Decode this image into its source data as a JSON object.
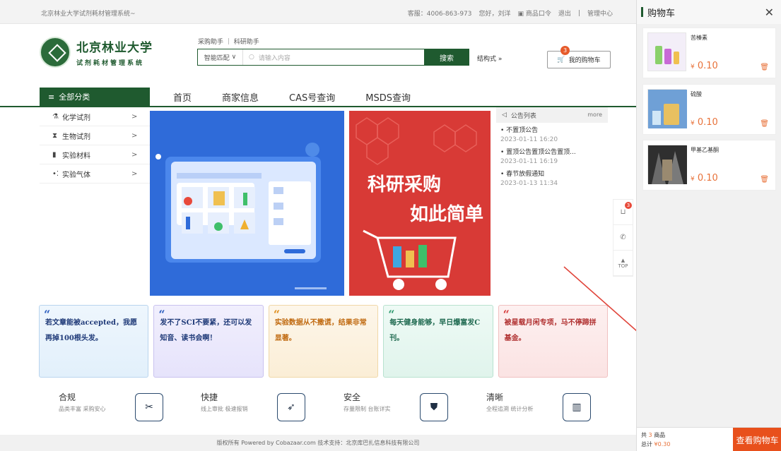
{
  "topbar": {
    "system_name": "北京林业大学试剂耗材管理系统~",
    "hotline": "客服：4006-863-973",
    "greeting": "您好，刘洋",
    "token": "商品口令",
    "logout": "退出",
    "sep": "|",
    "admin": "管理中心"
  },
  "logo": {
    "name": "北京林业大学",
    "subtitle": "试剂耗材管理系统"
  },
  "search": {
    "assist": "采购助手 ｜ 科研助手",
    "mode": "智能匹配",
    "placeholder": "请输入内容",
    "button": "搜索",
    "structure": "结构式 »",
    "cart_label": "我的购物车",
    "cart_count": "3"
  },
  "nav": {
    "all": "全部分类",
    "items": [
      "首页",
      "商家信息",
      "CAS号查询",
      "MSDS查询"
    ]
  },
  "categories": [
    {
      "icon": "flask-icon",
      "label": "化学试剂"
    },
    {
      "icon": "hourglass-icon",
      "label": "生物试剂"
    },
    {
      "icon": "vial-icon",
      "label": "实验材料"
    },
    {
      "icon": "gas-icon",
      "label": "实验气体"
    }
  ],
  "banner2": {
    "line1": "科研采购",
    "line2": "如此简单"
  },
  "notice": {
    "title": "公告列表",
    "more": "more",
    "items": [
      {
        "title": "• 不置顶公告",
        "date": "2023-01-11 16:20"
      },
      {
        "title": "• 置顶公告置顶公告置顶...",
        "date": "2023-01-11 16:19"
      },
      {
        "title": "• 春节放假通知",
        "date": "2023-01-13 11:34"
      }
    ]
  },
  "side_tools": {
    "cart_badge": "3",
    "top": "TOP"
  },
  "cards": [
    "若文章能被accepted，我愿再掉100根头发。",
    "发不了SCI不要紧，还可以发知音、读书会啊！",
    "实验数据从不撒谎，结果非常显著。",
    "每天健身能够，早日爆富发C刊。",
    "被星载月闲专项，马不停蹄拼基金。"
  ],
  "features": [
    {
      "title": "合规",
      "sub": "品类丰富 采购安心",
      "icon": "percent-icon"
    },
    {
      "title": "快捷",
      "sub": "线上审批 极速报销",
      "icon": "rocket-icon"
    },
    {
      "title": "安全",
      "sub": "存量限制 台账详实",
      "icon": "shield-icon"
    },
    {
      "title": "清晰",
      "sub": "全程追溯 统计分析",
      "icon": "chart-icon"
    }
  ],
  "footer": "版权所有 Powered by Cobazaar.com 技术支持：北京库巴扎信息科技有限公司",
  "cart_panel": {
    "title": "购物车",
    "items": [
      {
        "name": "苦榛素",
        "price": "0.10"
      },
      {
        "name": "硫酸",
        "price": "0.10"
      },
      {
        "name": "甲基乙基酮",
        "price": "0.10"
      }
    ],
    "currency": "¥",
    "count_prefix": "共",
    "count": "3",
    "count_suffix": "商品",
    "total_label": "总计",
    "total": "¥0.30",
    "checkout": "查看购物车"
  },
  "colors": {
    "brand_green": "#1f5a2f",
    "accent_orange": "#e8501c",
    "price": "#e8723a"
  }
}
